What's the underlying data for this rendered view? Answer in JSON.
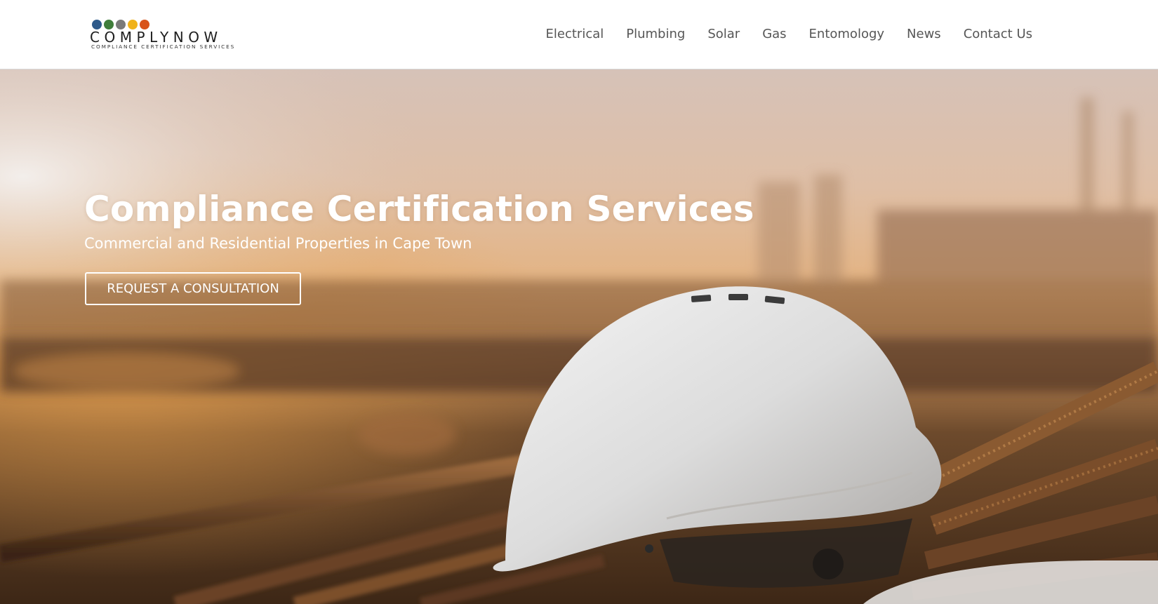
{
  "header": {
    "logo": {
      "name": "COMPLYNOW",
      "tagline": "COMPLIANCE CERTIFICATION SERVICES",
      "dot_colors": [
        "#2e5a8a",
        "#3f7d3a",
        "#7a7a7a",
        "#f0b21a",
        "#d8531a"
      ],
      "dot_icons": [
        "lightning-icon",
        "leaf-icon",
        "faucet-icon",
        "sun-icon",
        "flame-icon"
      ]
    },
    "nav": [
      {
        "label": "Electrical"
      },
      {
        "label": "Plumbing"
      },
      {
        "label": "Solar"
      },
      {
        "label": "Gas"
      },
      {
        "label": "Entomology"
      },
      {
        "label": "News"
      },
      {
        "label": "Contact Us"
      }
    ]
  },
  "hero": {
    "title": "Compliance Certification Services",
    "subtitle": "Commercial and Residential Properties in Cape Town",
    "cta_label": "REQUEST A CONSULTATION",
    "background_image": "white-hard-hat-on-steel-rebar-at-sunset",
    "colors": {
      "sky_top": "#d7c2b7",
      "sky_mid": "#e6b891",
      "sunset": "#d99a55",
      "ground": "#5a3a22",
      "helmet": "#e9e9e9"
    }
  }
}
